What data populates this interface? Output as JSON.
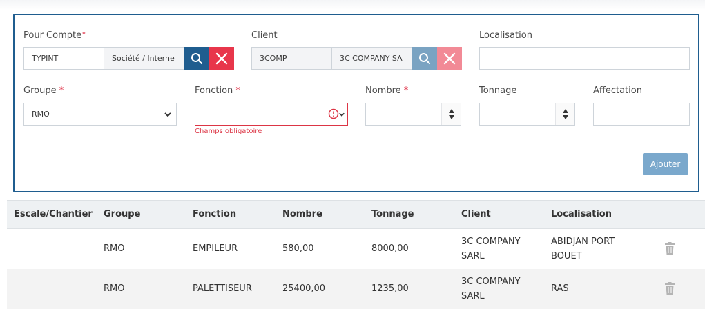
{
  "form": {
    "pour_compte": {
      "label": "Pour Compte",
      "required_mark": "*",
      "code": "TYPINT",
      "name": "Société / Interne"
    },
    "client": {
      "label": "Client",
      "code": "3COMP",
      "name": "3C COMPANY SA"
    },
    "localisation": {
      "label": "Localisation",
      "value": ""
    },
    "groupe": {
      "label": "Groupe",
      "required_mark": "*",
      "selected": "RMO"
    },
    "fonction": {
      "label": "Fonction",
      "required_mark": "*",
      "selected": "",
      "error": "Champs obligatoire"
    },
    "nombre": {
      "label": "Nombre",
      "required_mark": "*",
      "value": ""
    },
    "tonnage": {
      "label": "Tonnage",
      "value": ""
    },
    "affectation": {
      "label": "Affectation",
      "value": ""
    },
    "add_label": "Ajouter"
  },
  "table": {
    "headers": [
      "Escale/Chantier",
      "Groupe",
      "Fonction",
      "Nombre",
      "Tonnage",
      "Client",
      "Localisation"
    ],
    "rows": [
      {
        "escale": "",
        "groupe": "RMO",
        "fonction": "EMPILEUR",
        "nombre": "580,00",
        "tonnage": "8000,00",
        "client_l1": "3C COMPANY",
        "client_l2": "SARL",
        "loc_l1": "ABIDJAN PORT",
        "loc_l2": "BOUET"
      },
      {
        "escale": "",
        "groupe": "RMO",
        "fonction": "PALETTISEUR",
        "nombre": "25400,00",
        "tonnage": "1235,00",
        "client_l1": "3C COMPANY",
        "client_l2": "SARL",
        "loc_l1": "RAS",
        "loc_l2": ""
      }
    ]
  },
  "colors": {
    "primary": "#1f5d8f",
    "danger": "#e8364b",
    "add_button": "#7aa8cc"
  }
}
